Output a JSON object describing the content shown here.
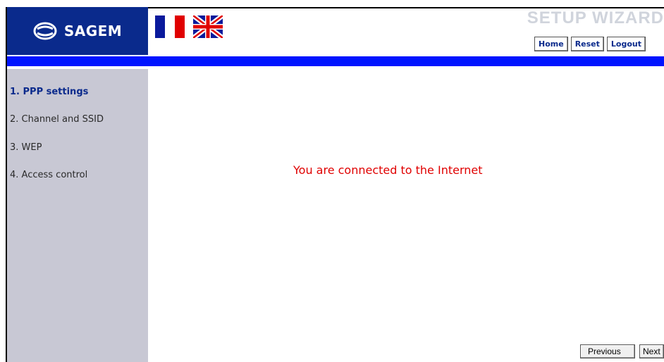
{
  "header": {
    "brand": "SAGEM",
    "title": "SETUP WIZARD",
    "buttons": {
      "home": "Home",
      "reset": "Reset",
      "logout": "Logout"
    },
    "languages": [
      "french-flag",
      "uk-flag"
    ]
  },
  "sidebar": {
    "items": [
      {
        "label": "1. PPP settings"
      },
      {
        "label": "2. Channel and SSID"
      },
      {
        "label": "3. WEP"
      },
      {
        "label": "4. Access control"
      }
    ]
  },
  "main": {
    "message": "You are connected to the Internet"
  },
  "footer": {
    "previous": "Previous",
    "next": "Next"
  },
  "colors": {
    "brand_blue": "#0a2a8c",
    "bar_blue": "#0014ff",
    "sidebar_bg": "#c8c8d4",
    "message_red": "#e00000",
    "title_gray": "#d0d4dc"
  }
}
